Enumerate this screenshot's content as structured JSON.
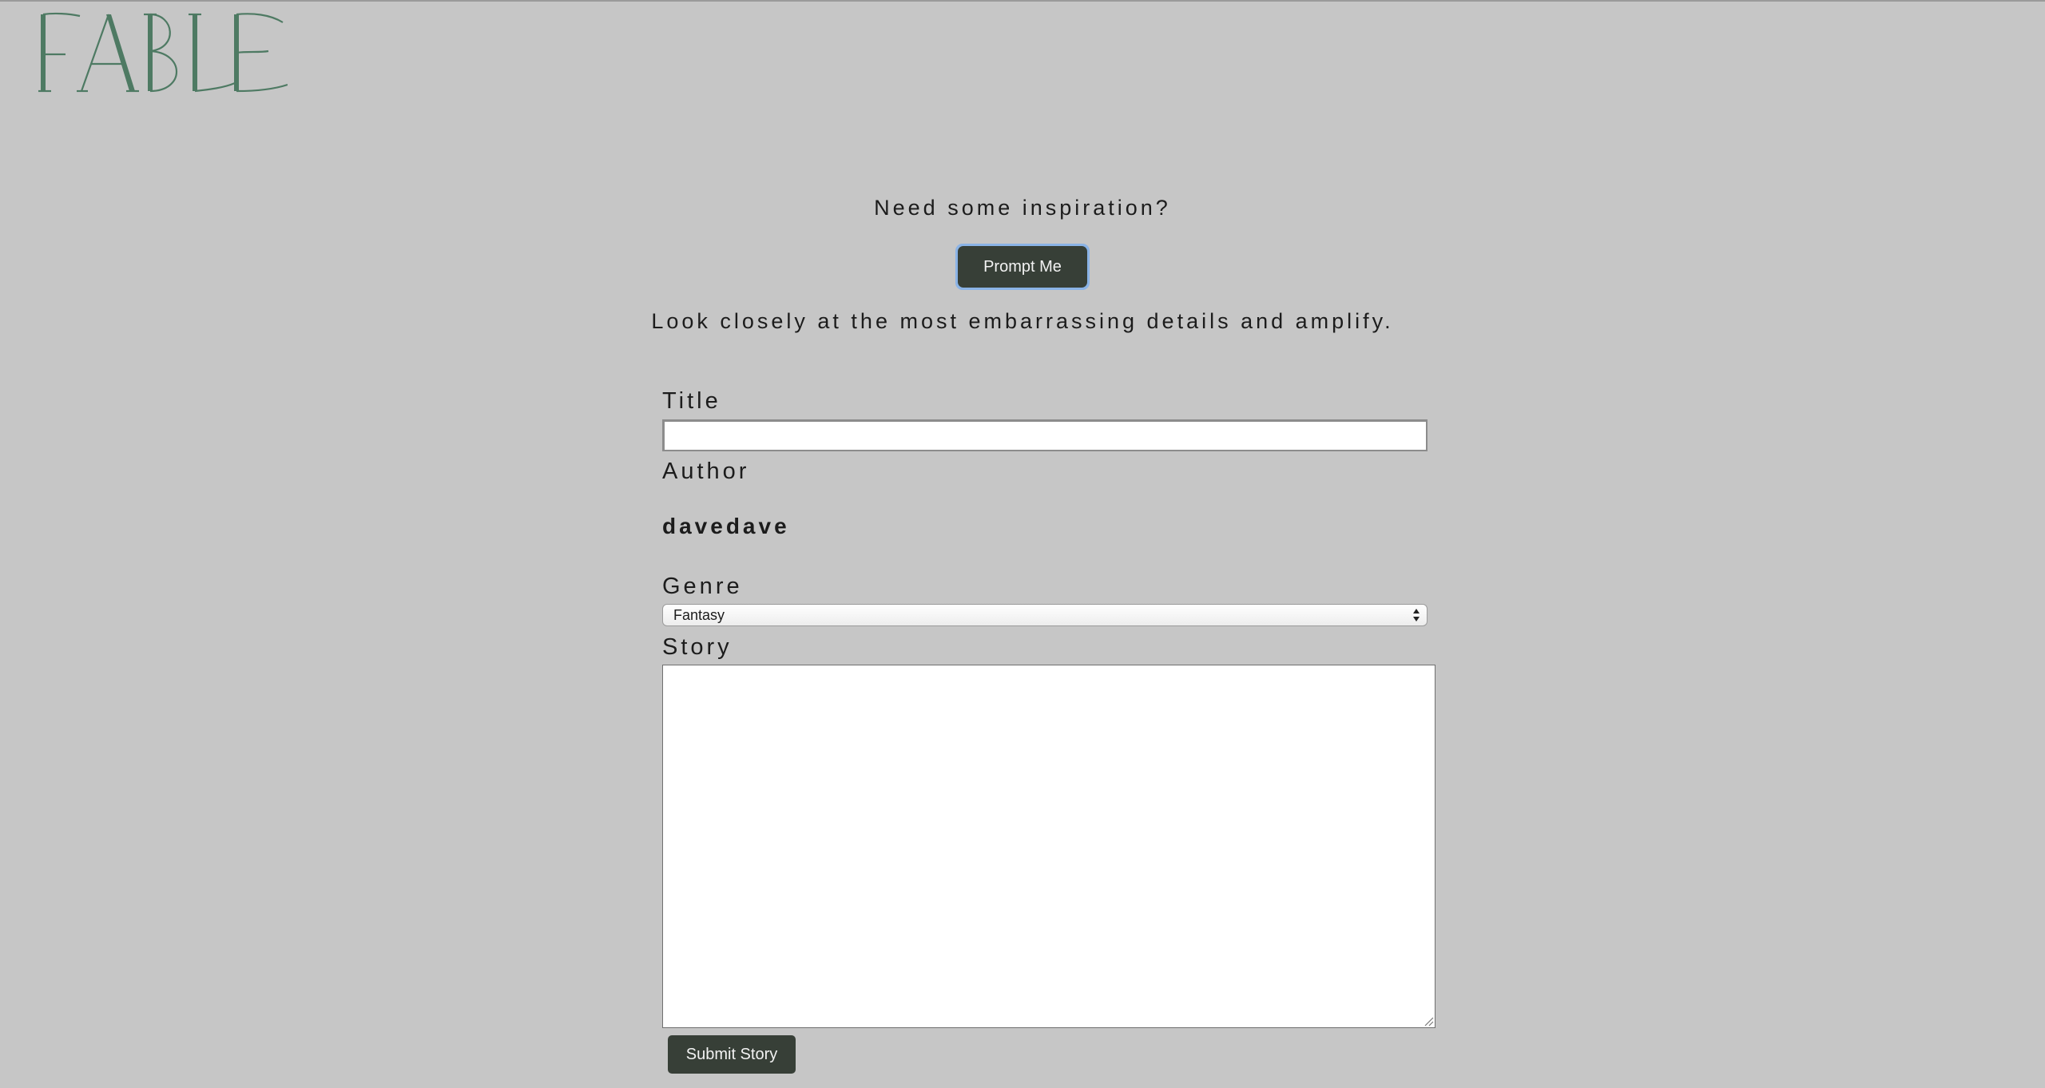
{
  "brand": {
    "logo_text": "FABLE",
    "logo_color": "#4e7a63"
  },
  "inspiration": {
    "heading": "Need some inspiration?",
    "button_label": "Prompt Me",
    "prompt_text": "Look closely at the most embarrassing details and amplify."
  },
  "form": {
    "title_label": "Title",
    "title_value": "",
    "author_label": "Author",
    "author_value": "davedave",
    "genre_label": "Genre",
    "genre_selected": "Fantasy",
    "story_label": "Story",
    "story_value": "",
    "submit_label": "Submit Story"
  },
  "colors": {
    "background": "#c6c6c6",
    "button": "#373f37",
    "button_text": "#f2f2f2",
    "focus_ring": "#8ab3e6"
  },
  "icons": {
    "select_arrows": "up-down-arrows-icon",
    "resize_grip": "resize-grip-icon"
  }
}
